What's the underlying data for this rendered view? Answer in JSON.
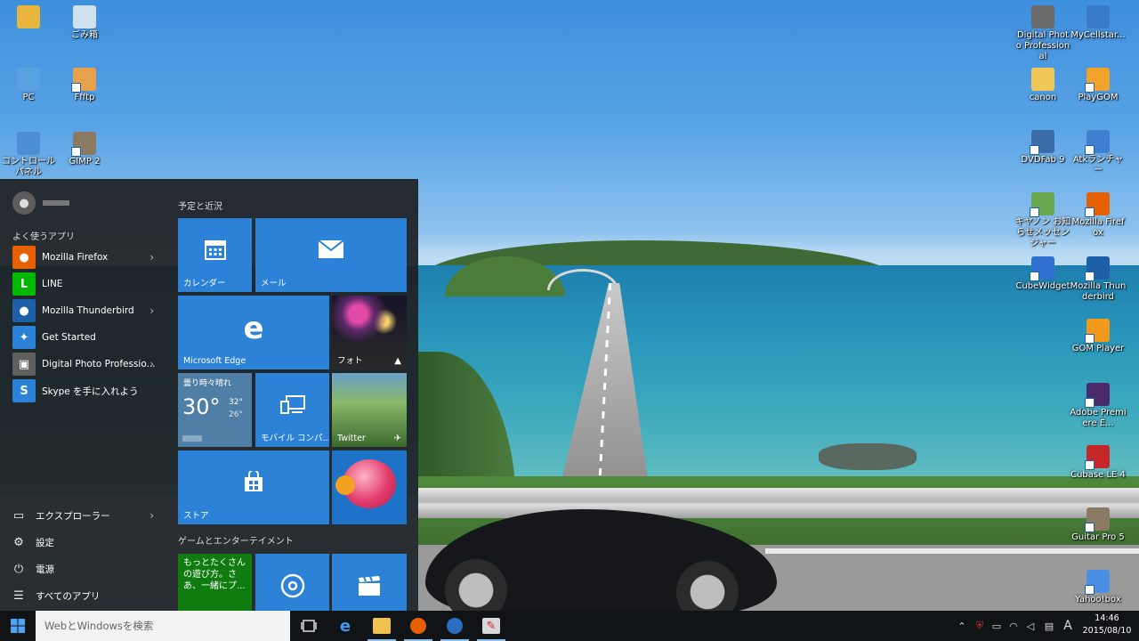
{
  "desktop": {
    "icons_left": [
      {
        "name": "user-folder-icon",
        "label": "",
        "color": "#e8b53f"
      },
      {
        "name": "recycle-bin-icon",
        "label": "ごみ箱",
        "color": "#cfe0ee"
      },
      {
        "name": "pc-icon",
        "label": "PC",
        "color": "#5aa3e0"
      },
      {
        "name": "ffftp-icon",
        "label": "Ffftp",
        "color": "#e8a14b"
      },
      {
        "name": "control-panel-icon",
        "label": "コントロール パネル",
        "color": "#4d8fd6"
      },
      {
        "name": "gimp-icon",
        "label": "GIMP 2",
        "color": "#8a7a63"
      }
    ],
    "icons_right": [
      {
        "name": "digital-photo-professional-icon",
        "label": "Digital Photo Professional",
        "color": "#6b6b6b"
      },
      {
        "name": "mycellstar-icon",
        "label": "MyCellstar...",
        "color": "#3a7bc8"
      },
      {
        "name": "canon-folder-icon",
        "label": "canon",
        "color": "#f0c85a"
      },
      {
        "name": "playgom-icon",
        "label": "PlayGOM",
        "color": "#f2a12c"
      },
      {
        "name": "dvdfab-icon",
        "label": "DVDFab 9",
        "color": "#3b6ea8"
      },
      {
        "name": "atok-launcher-icon",
        "label": "Atkランチャー",
        "color": "#3f7fd0"
      },
      {
        "name": "canon-message-icon",
        "label": "キヤノン お知らせメッセンジャー",
        "color": "#6aa84f"
      },
      {
        "name": "mozilla-firefox-desktop-icon",
        "label": "Mozilla Firefox",
        "color": "#e66000"
      },
      {
        "name": "cubewidget-icon",
        "label": "CubeWidget",
        "color": "#2f6fd0"
      },
      {
        "name": "mozilla-thunderbird-desktop-icon",
        "label": "Mozilla Thunderbird",
        "color": "#1f5fa8"
      },
      {
        "name": "gom-player-icon",
        "label": "GOM Player",
        "color": "#f29a1c"
      },
      {
        "name": "adobe-premiere-icon",
        "label": "Adobe Premiere E...",
        "color": "#4b2a6b"
      },
      {
        "name": "cubase-icon",
        "label": "Cubase LE 4",
        "color": "#c62828"
      },
      {
        "name": "guitar-pro-icon",
        "label": "Guitar Pro 5",
        "color": "#8a7a63"
      },
      {
        "name": "yahoo-box-icon",
        "label": "Yahoo!box",
        "color": "#4a90e2"
      }
    ]
  },
  "start_menu": {
    "user_name": "",
    "most_used_label": "よく使うアプリ",
    "apps": [
      {
        "name": "Mozilla Firefox",
        "icon": "firefox-icon",
        "color": "#e66000",
        "glyph": "●",
        "has_arrow": true
      },
      {
        "name": "LINE",
        "icon": "line-icon",
        "color": "#00b900",
        "glyph": "L",
        "has_arrow": false
      },
      {
        "name": "Mozilla Thunderbird",
        "icon": "thunderbird-icon",
        "color": "#1f5fa8",
        "glyph": "●",
        "has_arrow": true
      },
      {
        "name": "Get Started",
        "icon": "get-started-icon",
        "color": "#2b82d6",
        "glyph": "✦",
        "has_arrow": false
      },
      {
        "name": "Digital Photo Professio...",
        "icon": "dpp-icon",
        "color": "#5f5f5f",
        "glyph": "▣",
        "has_arrow": true
      },
      {
        "name": "Skype を手に入れよう",
        "icon": "skype-icon",
        "color": "#2b82d6",
        "glyph": "S",
        "has_arrow": false
      }
    ],
    "bottom": [
      {
        "name": "エクスプローラー",
        "icon": "file-explorer-icon",
        "glyph": "▭",
        "has_arrow": true
      },
      {
        "name": "設定",
        "icon": "settings-gear-icon",
        "glyph": "⚙",
        "has_arrow": false
      },
      {
        "name": "電源",
        "icon": "power-icon",
        "glyph": "⏻",
        "has_arrow": false
      },
      {
        "name": "すべてのアプリ",
        "icon": "all-apps-icon",
        "glyph": "☰",
        "has_arrow": false
      }
    ],
    "tiles_header": "予定と近況",
    "games_header": "ゲームとエンターテイメント",
    "tiles": {
      "calendar": "カレンダー",
      "mail": "メール",
      "edge": "Microsoft Edge",
      "photos": "フォト",
      "weather_condition": "曇り時々晴れ",
      "weather_temp": "30°",
      "weather_high": "32°",
      "weather_low": "26°",
      "mobile": "モバイル コンパ...",
      "twitter": "Twitter",
      "store": "ストア",
      "xbox_text": "もっとたくさんの遊び方。さあ、一緒にプ..."
    }
  },
  "taskbar": {
    "search_placeholder": "WebとWindowsを検索",
    "time": "14:46",
    "date": "2015/08/10",
    "ime": "A"
  },
  "colors": {
    "accent": "#2b82d6",
    "start_bg": "#1e2022",
    "taskbar_bg": "#111417"
  }
}
